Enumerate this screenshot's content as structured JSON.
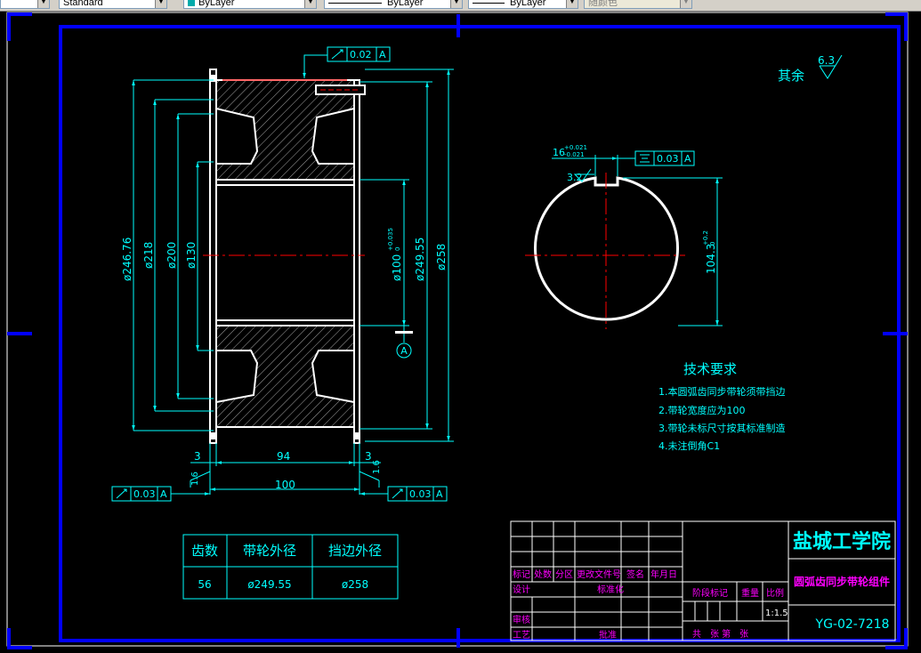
{
  "toolbar": {
    "text_style": "Standard",
    "color": "ByLayer",
    "linetype": "ByLayer",
    "lineweight": "ByLayer",
    "plot_style": "随颜色"
  },
  "drawing": {
    "roughness_note_label": "其余",
    "roughness_note_value": "6.3",
    "left_view": {
      "top_tolerance": "0.02",
      "top_datum": "A",
      "dims": {
        "d1": "ø246.76",
        "d2": "ø218",
        "d3": "ø200",
        "d4": "ø130",
        "bore": "ø100",
        "bore_tol_upper": "+0.035",
        "bore_tol_lower": "0",
        "d5": "ø249.55",
        "d6": "ø258"
      },
      "datum_label": "A",
      "width_dims": {
        "w_left": "3",
        "w_mid": "94",
        "w_right": "3",
        "w_total": "100"
      },
      "roughness_left": "1.6",
      "roughness_right": "1.6",
      "bottom_left_tol": "0.03",
      "bottom_left_datum": "A",
      "bottom_right_tol": "0.03",
      "bottom_right_datum": "A"
    },
    "right_view": {
      "keyway_width": "16",
      "keyway_tol_upper": "+0.021",
      "keyway_tol_lower": "-0.021",
      "keyway_roughness": "3.2",
      "symmetry_tol": "0.03",
      "symmetry_datum": "A",
      "keyway_depth": "104.3",
      "keyway_depth_tol_upper": "+0.2",
      "keyway_depth_tol_lower": "0"
    },
    "tech_requirements": {
      "title": "技术要求",
      "items": [
        "1.本圆弧齿同步带轮须带挡边",
        "2.带轮宽度应为100",
        "3.带轮未标尺寸按其标准制造",
        "4.未注倒角C1"
      ]
    },
    "param_table": {
      "headers": [
        "齿数",
        "带轮外径",
        "挡边外径"
      ],
      "row": [
        "56",
        "ø249.55",
        "ø258"
      ]
    },
    "title_block": {
      "school": "盐城工学院",
      "part_name": "圆弧齿同步带轮组件",
      "drawing_no": "YG-02-7218",
      "scale": "1:1.5",
      "labels": {
        "mark": "标记",
        "count": "处数",
        "zone": "分区",
        "change_doc": "更改文件号",
        "sign": "签名",
        "date": "年月日",
        "design": "设计",
        "standardize": "标准化",
        "stage_mark": "阶段标记",
        "weight": "重量",
        "scale_label": "比例",
        "review": "审核",
        "process": "工艺",
        "approve": "批准",
        "sheets": "共　张 第　张"
      }
    }
  }
}
